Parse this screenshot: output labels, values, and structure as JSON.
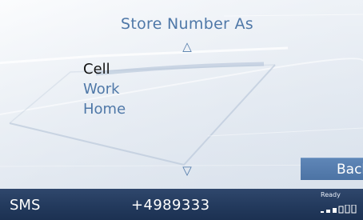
{
  "screen": {
    "title": "Store Number As"
  },
  "menu": {
    "items": [
      {
        "label": "Cell",
        "selected": true
      },
      {
        "label": "Work",
        "selected": false
      },
      {
        "label": "Home",
        "selected": false
      }
    ]
  },
  "nav": {
    "up_icon": "triangle-up",
    "down_icon": "triangle-down"
  },
  "buttons": {
    "back_label": "Back"
  },
  "status": {
    "left_label": "SMS",
    "number": "+4989333",
    "ready_label": "Ready",
    "signal_icon": "signal-strength"
  },
  "colors": {
    "accent": "#4f78a8",
    "selected_text": "#111111",
    "status_bar": "#243b5f",
    "back_button": "#587fb0"
  }
}
